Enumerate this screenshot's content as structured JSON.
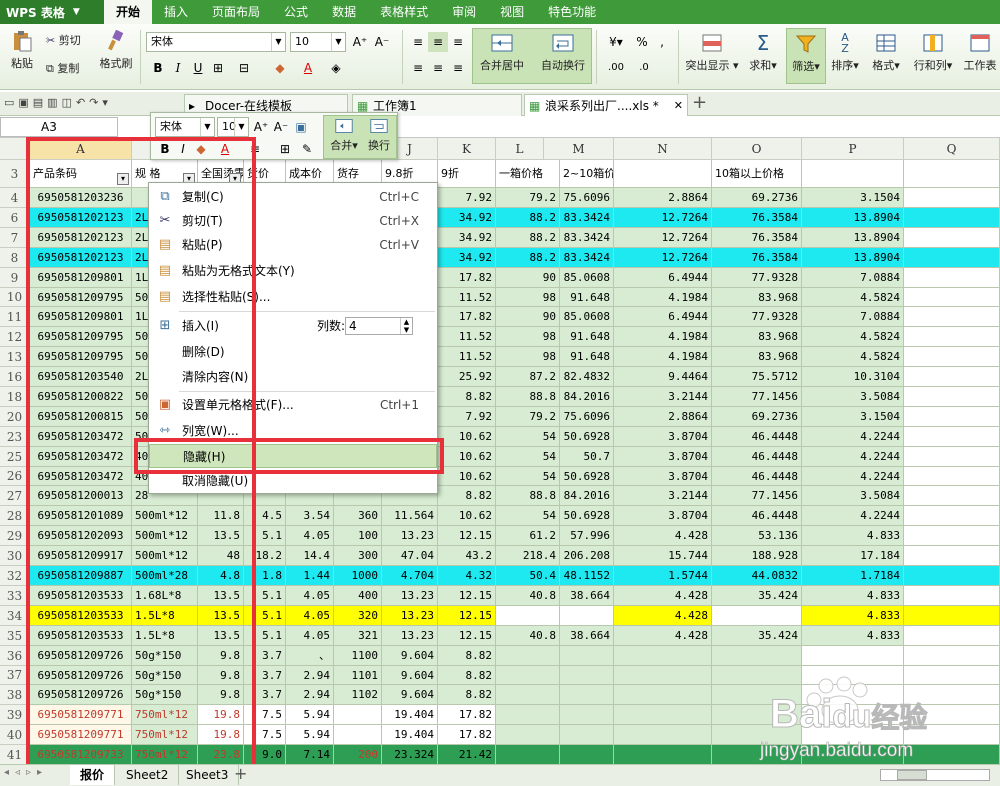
{
  "menubar": {
    "app": "WPS 表格",
    "tabs": [
      "开始",
      "插入",
      "页面布局",
      "公式",
      "数据",
      "表格样式",
      "审阅",
      "视图",
      "特色功能"
    ]
  },
  "ribbon": {
    "paste": "粘贴",
    "cut": "剪切",
    "copy": "复制",
    "format_painter": "格式刷",
    "font": "宋体",
    "font_size": "10",
    "merge_center": "合并居中",
    "wrap": "自动换行",
    "percent": "%",
    "highlight": "突出显示",
    "sum": "求和",
    "filter": "筛选",
    "sort": "排序",
    "format": "格式",
    "rows_cols": "行和列",
    "worksheet": "工作表"
  },
  "doctabs": [
    {
      "label": "Docer-在线模板"
    },
    {
      "label": "工作簿1"
    },
    {
      "label": "浪采系列出厂....xls *"
    }
  ],
  "formula": {
    "namebox": "A3"
  },
  "mini_toolbar": {
    "font": "宋体",
    "size": "10",
    "merge": "合并",
    "wrap": "换行"
  },
  "columns": [
    "A",
    "B",
    "C",
    "D",
    "E",
    "F",
    "G",
    "H",
    "I",
    "J",
    "K",
    "L",
    "M",
    "N",
    "O",
    "P",
    "Q"
  ],
  "header_row": {
    "row": "3",
    "a": "产品条码",
    "b": "规 格",
    "c": "全国烫零",
    "d": "货价",
    "e": "成本价",
    "f": "货存",
    "g": "9.8折",
    "h": "9折",
    "i": "一箱价格",
    "j": "2~10箱价格",
    "l": "10箱以上价格"
  },
  "rows": [
    {
      "n": "4",
      "a": "6950581203236",
      "b": "",
      "c": "",
      "d": "",
      "e": "",
      "f": "",
      "g": "",
      "h": "7.92",
      "i": "79.2",
      "j": "75.6096",
      "k": "2.8864",
      "l": "69.2736",
      "m": "3.1504",
      "bg": "#d7ecd2"
    },
    {
      "n": "6",
      "a": "6950581202123",
      "b": "2L",
      "c": "",
      "d": "",
      "e": "",
      "f": "",
      "g": "",
      "h": "34.92",
      "i": "88.2",
      "j": "83.3424",
      "k": "12.7264",
      "l": "76.3584",
      "m": "13.8904",
      "bg": "#1ee8f0"
    },
    {
      "n": "7",
      "a": "6950581202123",
      "b": "2L",
      "c": "",
      "d": "",
      "e": "",
      "f": "",
      "g": "",
      "h": "34.92",
      "i": "88.2",
      "j": "83.3424",
      "k": "12.7264",
      "l": "76.3584",
      "m": "13.8904",
      "bg": "#d7ecd2"
    },
    {
      "n": "8",
      "a": "6950581202123",
      "b": "2L",
      "c": "",
      "d": "",
      "e": "",
      "f": "",
      "g": "",
      "h": "34.92",
      "i": "88.2",
      "j": "83.3424",
      "k": "12.7264",
      "l": "76.3584",
      "m": "13.8904",
      "bg": "#1ee8f0"
    },
    {
      "n": "9",
      "a": "6950581209801",
      "b": "1L",
      "c": "",
      "d": "",
      "e": "",
      "f": "",
      "g": "",
      "h": "17.82",
      "i": "90",
      "j": "85.0608",
      "k": "6.4944",
      "l": "77.9328",
      "m": "7.0884",
      "bg": "#d7ecd2"
    },
    {
      "n": "10",
      "a": "6950581209795",
      "b": "50",
      "c": "",
      "d": "",
      "e": "",
      "f": "",
      "g": "",
      "h": "11.52",
      "i": "98",
      "j": "91.648",
      "k": "4.1984",
      "l": "83.968",
      "m": "4.5824",
      "bg": "#d7ecd2"
    },
    {
      "n": "11",
      "a": "6950581209801",
      "b": "1L",
      "c": "",
      "d": "",
      "e": "",
      "f": "",
      "g": "",
      "h": "17.82",
      "i": "90",
      "j": "85.0608",
      "k": "6.4944",
      "l": "77.9328",
      "m": "7.0884",
      "bg": "#d7ecd2"
    },
    {
      "n": "12",
      "a": "6950581209795",
      "b": "50",
      "c": "",
      "d": "",
      "e": "",
      "f": "",
      "g": "",
      "h": "11.52",
      "i": "98",
      "j": "91.648",
      "k": "4.1984",
      "l": "83.968",
      "m": "4.5824",
      "bg": "#d7ecd2"
    },
    {
      "n": "13",
      "a": "6950581209795",
      "b": "50",
      "c": "",
      "d": "",
      "e": "",
      "f": "",
      "g": "",
      "h": "11.52",
      "i": "98",
      "j": "91.648",
      "k": "4.1984",
      "l": "83.968",
      "m": "4.5824",
      "bg": "#d7ecd2"
    },
    {
      "n": "16",
      "a": "6950581203540",
      "b": "2L",
      "c": "",
      "d": "",
      "e": "",
      "f": "",
      "g": "",
      "h": "25.92",
      "i": "87.2",
      "j": "82.4832",
      "k": "9.4464",
      "l": "75.5712",
      "m": "10.3104",
      "bg": "#d7ecd2"
    },
    {
      "n": "18",
      "a": "6950581200822",
      "b": "50",
      "c": "",
      "d": "",
      "e": "",
      "f": "",
      "g": "",
      "h": "8.82",
      "i": "88.8",
      "j": "84.2016",
      "k": "3.2144",
      "l": "77.1456",
      "m": "3.5084",
      "bg": "#d7ecd2"
    },
    {
      "n": "20",
      "a": "6950581200815",
      "b": "50",
      "c": "",
      "d": "",
      "e": "",
      "f": "",
      "g": "",
      "h": "7.92",
      "i": "79.2",
      "j": "75.6096",
      "k": "2.8864",
      "l": "69.2736",
      "m": "3.1504",
      "bg": "#d7ecd2"
    },
    {
      "n": "23",
      "a": "6950581203472",
      "b": "50",
      "c": "",
      "d": "",
      "e": "",
      "f": "",
      "g": "",
      "h": "10.62",
      "i": "54",
      "j": "50.6928",
      "k": "3.8704",
      "l": "46.4448",
      "m": "4.2244",
      "bg": "#d7ecd2"
    },
    {
      "n": "25",
      "a": "6950581203472",
      "b": "40",
      "c": "",
      "d": "",
      "e": "",
      "f": "",
      "g": "",
      "h": "10.62",
      "i": "54",
      "j": "50.7",
      "k": "3.8704",
      "l": "46.4448",
      "m": "4.2244",
      "bg": "#d7ecd2"
    },
    {
      "n": "26",
      "a": "6950581203472",
      "b": "40",
      "c": "",
      "d": "",
      "e": "",
      "f": "",
      "g": "",
      "h": "10.62",
      "i": "54",
      "j": "50.6928",
      "k": "3.8704",
      "l": "46.4448",
      "m": "4.2244",
      "bg": "#d7ecd2"
    },
    {
      "n": "27",
      "a": "6950581200013",
      "b": "28",
      "c": "",
      "d": "",
      "e": "",
      "f": "",
      "g": "",
      "h": "8.82",
      "i": "88.8",
      "j": "84.2016",
      "k": "3.2144",
      "l": "77.1456",
      "m": "3.5084",
      "bg": "#d7ecd2"
    },
    {
      "n": "28",
      "a": "6950581201089",
      "b": "500ml*12",
      "c": "11.8",
      "d": "4.5",
      "e": "3.54",
      "f": "360",
      "g": "11.564",
      "h": "10.62",
      "i": "54",
      "j": "50.6928",
      "k": "3.8704",
      "l": "46.4448",
      "m": "4.2244",
      "bg": "#d7ecd2"
    },
    {
      "n": "29",
      "a": "6950581202093",
      "b": "500ml*12",
      "c": "13.5",
      "d": "5.1",
      "e": "4.05",
      "f": "100",
      "g": "13.23",
      "h": "12.15",
      "i": "61.2",
      "j": "57.996",
      "k": "4.428",
      "l": "53.136",
      "m": "4.833",
      "bg": "#d7ecd2"
    },
    {
      "n": "30",
      "a": "6950581209917",
      "b": "500ml*12",
      "c": "48",
      "d": "18.2",
      "e": "14.4",
      "f": "300",
      "g": "47.04",
      "h": "43.2",
      "i": "218.4",
      "j": "206.208",
      "k": "15.744",
      "l": "188.928",
      "m": "17.184",
      "bg": "#d7ecd2"
    },
    {
      "n": "32",
      "a": "6950581209887",
      "b": "500ml*28",
      "c": "4.8",
      "d": "1.8",
      "e": "1.44",
      "f": "1000",
      "g": "4.704",
      "h": "4.32",
      "i": "50.4",
      "j": "48.1152",
      "k": "1.5744",
      "l": "44.0832",
      "m": "1.7184",
      "bg": "#1ee8f0"
    },
    {
      "n": "33",
      "a": "6950581203533",
      "b": "1.68L*8",
      "c": "13.5",
      "d": "5.1",
      "e": "4.05",
      "f": "400",
      "g": "13.23",
      "h": "12.15",
      "i": "40.8",
      "j": "38.664",
      "k": "4.428",
      "l": "35.424",
      "m": "4.833",
      "bg": "#d7ecd2"
    },
    {
      "n": "34",
      "a": "6950581203533",
      "b": "1.5L*8",
      "c": "13.5",
      "d": "5.1",
      "e": "4.05",
      "f": "320",
      "g": "13.23",
      "h": "12.15",
      "i": "",
      "j": "",
      "k": "4.428",
      "l": "",
      "m": "4.833",
      "bg": "#ffff00"
    },
    {
      "n": "35",
      "a": "6950581203533",
      "b": "1.5L*8",
      "c": "13.5",
      "d": "5.1",
      "e": "4.05",
      "f": "321",
      "g": "13.23",
      "h": "12.15",
      "i": "40.8",
      "j": "38.664",
      "k": "4.428",
      "l": "35.424",
      "m": "4.833",
      "bg": "#d7ecd2"
    },
    {
      "n": "36",
      "a": "6950581209726",
      "b": "50g*150",
      "c": "9.8",
      "d": "3.7",
      "e": "、",
      "f": "1100",
      "g": "9.604",
      "h": "8.82",
      "i": "",
      "j": "",
      "k": "",
      "l": "",
      "m": "",
      "bg": "#d7ecd2"
    },
    {
      "n": "37",
      "a": "6950581209726",
      "b": "50g*150",
      "c": "9.8",
      "d": "3.7",
      "e": "2.94",
      "f": "1101",
      "g": "9.604",
      "h": "8.82",
      "i": "",
      "j": "",
      "k": "",
      "l": "",
      "m": "",
      "bg": "#d7ecd2"
    },
    {
      "n": "38",
      "a": "6950581209726",
      "b": "50g*150",
      "c": "9.8",
      "d": "3.7",
      "e": "2.94",
      "f": "1102",
      "g": "9.604",
      "h": "8.82",
      "i": "",
      "j": "",
      "k": "",
      "l": "",
      "m": "",
      "bg": "#d7ecd2"
    },
    {
      "n": "39",
      "a": "6950581209771",
      "b": "750ml*12",
      "c": "19.8",
      "d": "7.5",
      "e": "5.94",
      "f": "",
      "g": "19.404",
      "h": "17.82",
      "i": "",
      "j": "",
      "k": "",
      "l": "",
      "m": "",
      "bg": "#d7ecd2",
      "red": true
    },
    {
      "n": "40",
      "a": "6950581209771",
      "b": "750ml*12",
      "c": "19.8",
      "d": "7.5",
      "e": "5.94",
      "f": "",
      "g": "19.404",
      "h": "17.82",
      "i": "",
      "j": "",
      "k": "",
      "l": "",
      "m": "",
      "bg": "#d7ecd2",
      "red": true
    },
    {
      "n": "41",
      "a": "6950581209733",
      "b": "750ml*12",
      "c": "23.8",
      "d": "9.0",
      "e": "7.14",
      "f": "200",
      "g": "23.324",
      "h": "21.42",
      "i": "",
      "j": "",
      "k": "",
      "l": "",
      "m": "",
      "bg": "#2e9e55",
      "red": true
    }
  ],
  "context_menu": {
    "items": [
      {
        "label": "复制(C)",
        "shortcut": "Ctrl+C",
        "icon": "copy-icon"
      },
      {
        "label": "剪切(T)",
        "shortcut": "Ctrl+X",
        "icon": "cut-icon"
      },
      {
        "label": "粘贴(P)",
        "shortcut": "Ctrl+V",
        "icon": "paste-icon"
      },
      {
        "label": "粘贴为无格式文本(Y)",
        "shortcut": "",
        "icon": "paste-text-icon"
      },
      {
        "label": "选择性粘贴(S)...",
        "shortcut": "",
        "icon": "paste-special-icon"
      },
      {
        "label": "插入(I)",
        "shortcut": "",
        "icon": "insert-icon"
      },
      {
        "label": "删除(D)",
        "shortcut": "",
        "icon": ""
      },
      {
        "label": "清除内容(N)",
        "shortcut": "",
        "icon": ""
      },
      {
        "label": "设置单元格格式(F)...",
        "shortcut": "Ctrl+1",
        "icon": "format-cells-icon"
      },
      {
        "label": "列宽(W)...",
        "shortcut": "",
        "icon": "column-width-icon"
      },
      {
        "label": "隐藏(H)",
        "shortcut": "",
        "icon": ""
      },
      {
        "label": "取消隐藏(U)",
        "shortcut": "",
        "icon": ""
      }
    ],
    "col_count_label": "列数:",
    "col_count_value": "4"
  },
  "sheets": [
    "报价",
    "Sheet2",
    "Sheet3"
  ],
  "watermark": {
    "brand": "Bai",
    "brand2": "du",
    "cn": "经验",
    "url": "jingyan.baidu.com"
  },
  "colors": {
    "accent": "#3f9a3a",
    "annotation": "#e8303a",
    "cell_green": "#d7ecd2",
    "cyan": "#1ee8f0",
    "yellow": "#ffff00",
    "dark_green": "#2e9e55"
  }
}
